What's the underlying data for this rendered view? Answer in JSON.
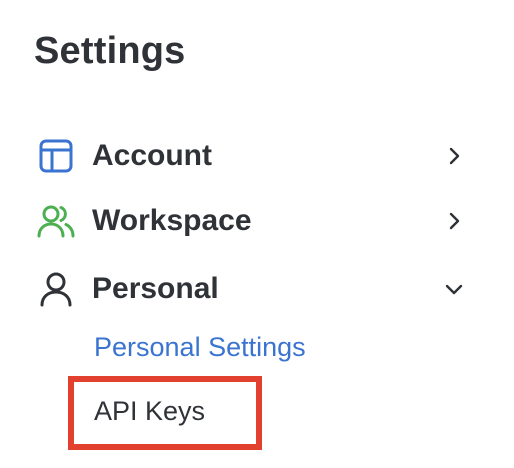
{
  "page": {
    "title": "Settings"
  },
  "nav": {
    "items": [
      {
        "label": "Account",
        "icon": "layout-icon",
        "icon_color": "#3a74d0",
        "chevron": "chevron-right-icon"
      },
      {
        "label": "Workspace",
        "icon": "users-icon",
        "icon_color": "#4caf50",
        "chevron": "chevron-right-icon"
      },
      {
        "label": "Personal",
        "icon": "user-icon",
        "icon_color": "#2f3237",
        "chevron": "chevron-down-icon"
      }
    ],
    "personal_subitems": [
      {
        "label": "Personal Settings",
        "color": "#3a74d0"
      },
      {
        "label": "API Keys",
        "color": "#2f3237"
      }
    ]
  },
  "highlight": {
    "color": "#e3412f"
  }
}
